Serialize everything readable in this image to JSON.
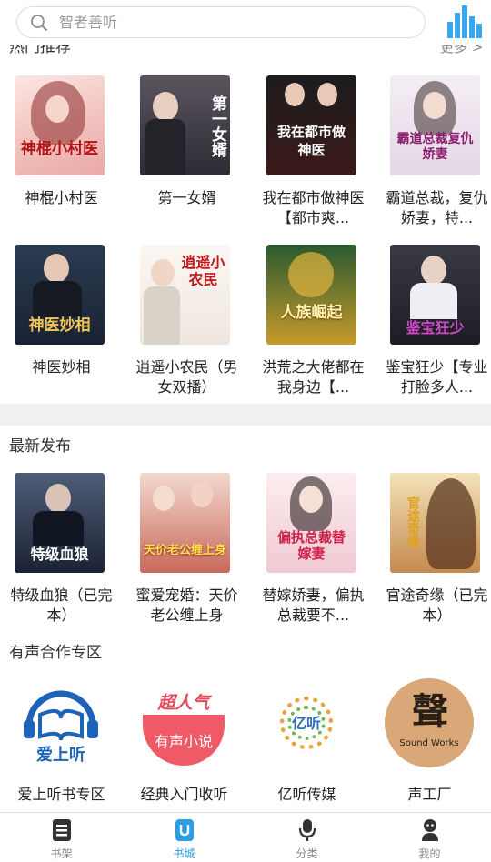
{
  "search": {
    "placeholder": "智者善听"
  },
  "hot": {
    "title": "热门推荐",
    "more": "更多 >",
    "books": [
      {
        "title": "神棍小村医",
        "cover_text": "神棍小村医"
      },
      {
        "title": "第一女婿",
        "cover_text": "第一女婿"
      },
      {
        "title": "我在都市做神医【都市爽...",
        "cover_text": "我在都市做神医"
      },
      {
        "title": "霸道总裁，复仇娇妻，特...",
        "cover_text": "霸道总裁复仇娇妻"
      },
      {
        "title": "神医妙相",
        "cover_text": "神医妙相"
      },
      {
        "title": "逍遥小农民（男女双播）",
        "cover_text": "逍遥小农民"
      },
      {
        "title": "洪荒之大佬都在我身边【...",
        "cover_text": "人族崛起"
      },
      {
        "title": "鉴宝狂少【专业打脸多人...",
        "cover_text": "鉴宝狂少"
      }
    ]
  },
  "latest": {
    "title": "最新发布",
    "books": [
      {
        "title": "特级血狼（已完本）",
        "cover_text": "特级血狼"
      },
      {
        "title": "蜜爱宠婚：天价老公缠上身",
        "cover_text": "天价老公缠上身"
      },
      {
        "title": "替嫁娇妻，偏执总裁要不...",
        "cover_text": "偏执总裁替嫁妻"
      },
      {
        "title": "官途奇缘（已完本）",
        "cover_text": "官途奇缘"
      }
    ]
  },
  "audio": {
    "title": "有声合作专区",
    "items": [
      {
        "label": "爱上听书专区",
        "logo_text": "爱上听"
      },
      {
        "label": "经典入门收听",
        "logo_text_top": "超人气",
        "logo_text": "有声小说"
      },
      {
        "label": "亿听传媒",
        "logo_text": "亿听"
      },
      {
        "label": "声工厂",
        "logo_text": "Sound Works"
      }
    ]
  },
  "nav": {
    "items": [
      {
        "label": "书架",
        "icon": "bookshelf-icon",
        "active": false
      },
      {
        "label": "书城",
        "icon": "store-icon",
        "active": true
      },
      {
        "label": "分类",
        "icon": "microphone-icon",
        "active": false
      },
      {
        "label": "我的",
        "icon": "user-icon",
        "active": false
      }
    ]
  },
  "colors": {
    "accent": "#2a9fe8",
    "inactive": "#888888",
    "divider": "#f1f1f1"
  }
}
